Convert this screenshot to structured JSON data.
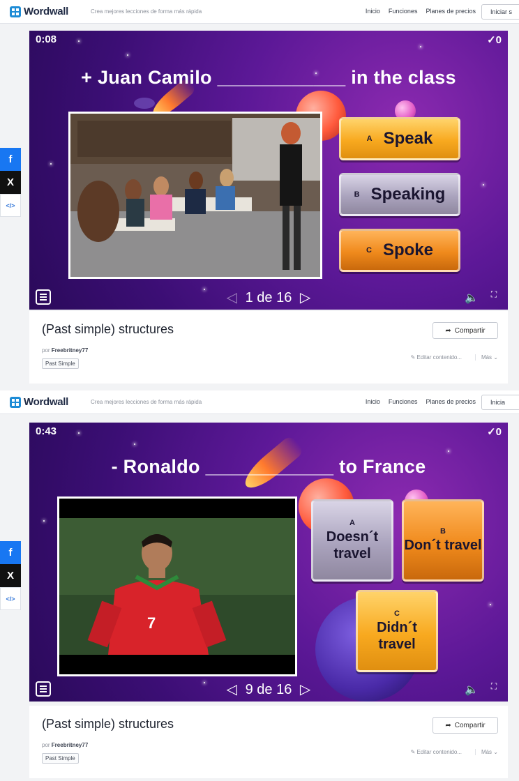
{
  "screens": [
    {
      "nav": {
        "logo": "Wordwall",
        "tagline": "Crea mejores lecciones de forma más rápida",
        "links": [
          "Inicio",
          "Funciones",
          "Planes de precios"
        ],
        "cta": "Iniciar s"
      },
      "social": {
        "facebook": "f",
        "x": "X",
        "embed": "</>"
      },
      "game": {
        "timer": "0:08",
        "score": "✓0",
        "question": "+ Juan Camilo ____________ in the class",
        "answers": [
          {
            "letter": "A",
            "text": "Speak",
            "color": "#f8a91f"
          },
          {
            "letter": "B",
            "text": "Speaking",
            "color": "#aaa3bd"
          },
          {
            "letter": "C",
            "text": "Spoke",
            "color": "#f08a1c"
          }
        ],
        "pager": "1 de 16",
        "prev_icon": "◁",
        "next_icon": "▷",
        "sound_icon": "🔈",
        "fullscreen_icon": "⛶"
      },
      "info": {
        "title": "(Past simple) structures",
        "share": "Compartir",
        "author_prefix": "por",
        "author": "Freebritney77",
        "tag": "Past Simple",
        "edit": "Editar contenido...",
        "more": "Más"
      }
    },
    {
      "nav": {
        "logo": "Wordwall",
        "tagline": "Crea mejores lecciones de forma más rápida",
        "links": [
          "Inicio",
          "Funciones",
          "Planes de precios"
        ],
        "cta": "Inicia"
      },
      "social": {
        "facebook": "f",
        "x": "X",
        "embed": "</>"
      },
      "game": {
        "timer": "0:43",
        "score": "✓0",
        "question": "- Ronaldo ____________ to France",
        "answers": [
          {
            "letter": "A",
            "text": "Doesn´t travel",
            "color": "#aaa3bd"
          },
          {
            "letter": "B",
            "text": "Don´t travel",
            "color": "#f08a1c"
          },
          {
            "letter": "C",
            "text": "Didn´t travel",
            "color": "#f8a91f"
          }
        ],
        "pager": "9 de 16",
        "prev_icon": "◁",
        "next_icon": "▷",
        "sound_icon": "🔈",
        "fullscreen_icon": "⛶"
      },
      "info": {
        "title": "(Past simple) structures",
        "share": "Compartir",
        "author_prefix": "por",
        "author": "Freebritney77",
        "tag": "Past Simple",
        "edit": "Editar contenido...",
        "more": "Más"
      }
    }
  ]
}
